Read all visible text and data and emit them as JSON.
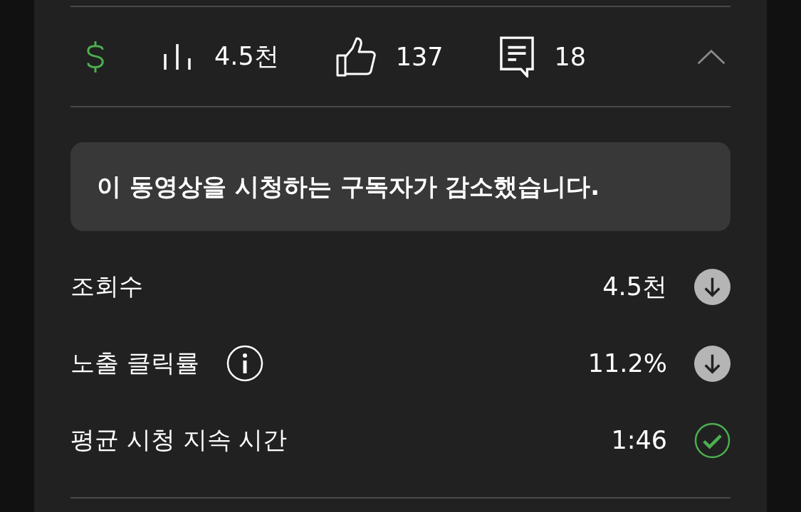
{
  "stats_bar": {
    "monetization": {
      "enabled": true
    },
    "stats": [
      {
        "kind": "views",
        "value": "4.5천"
      },
      {
        "kind": "likes",
        "value": "137"
      },
      {
        "kind": "comments",
        "value": "18"
      }
    ],
    "expanded": true
  },
  "notice": "이 동영상을 시청하는 구독자가 감소했습니다.",
  "metrics": [
    {
      "label": "조회수",
      "info": false,
      "value": "4.5천",
      "kind": "down"
    },
    {
      "label": "노출 클릭률",
      "info": true,
      "value": "11.2%",
      "kind": "down"
    },
    {
      "label": "평균 시청 지속 시간",
      "info": false,
      "value": "1:46",
      "kind": "ok"
    }
  ]
}
